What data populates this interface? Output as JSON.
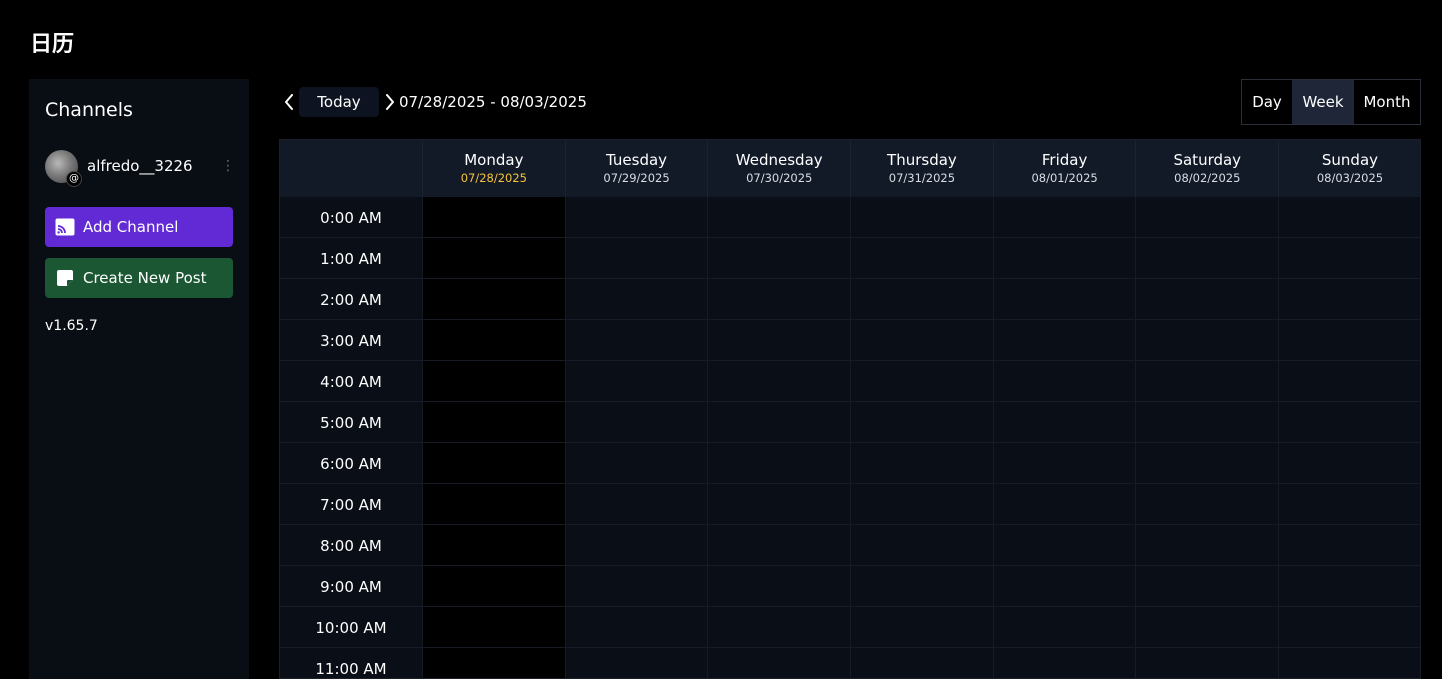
{
  "page": {
    "title": "日历"
  },
  "sidebar": {
    "title": "Channels",
    "channel": {
      "name": "alfredo__3226",
      "badge_icon": "threads-icon"
    },
    "add_channel_label": "Add Channel",
    "create_post_label": "Create New Post",
    "version": "v1.65.7"
  },
  "toolbar": {
    "today_label": "Today",
    "date_range": "07/28/2025 - 08/03/2025",
    "views": {
      "day": "Day",
      "week": "Week",
      "month": "Month"
    },
    "active_view": "Week"
  },
  "calendar": {
    "days": [
      {
        "name": "Monday",
        "date": "07/28/2025",
        "today": true
      },
      {
        "name": "Tuesday",
        "date": "07/29/2025",
        "today": false
      },
      {
        "name": "Wednesday",
        "date": "07/30/2025",
        "today": false
      },
      {
        "name": "Thursday",
        "date": "07/31/2025",
        "today": false
      },
      {
        "name": "Friday",
        "date": "08/01/2025",
        "today": false
      },
      {
        "name": "Saturday",
        "date": "08/02/2025",
        "today": false
      },
      {
        "name": "Sunday",
        "date": "08/03/2025",
        "today": false
      }
    ],
    "times": [
      "0:00 AM",
      "1:00 AM",
      "2:00 AM",
      "3:00 AM",
      "4:00 AM",
      "5:00 AM",
      "6:00 AM",
      "7:00 AM",
      "8:00 AM",
      "9:00 AM",
      "10:00 AM",
      "11:00 AM"
    ]
  },
  "colors": {
    "accent_purple": "#612ad5",
    "accent_green": "#1b5733",
    "today_date": "#f5c33c",
    "active_view_bg": "#1e2638"
  }
}
